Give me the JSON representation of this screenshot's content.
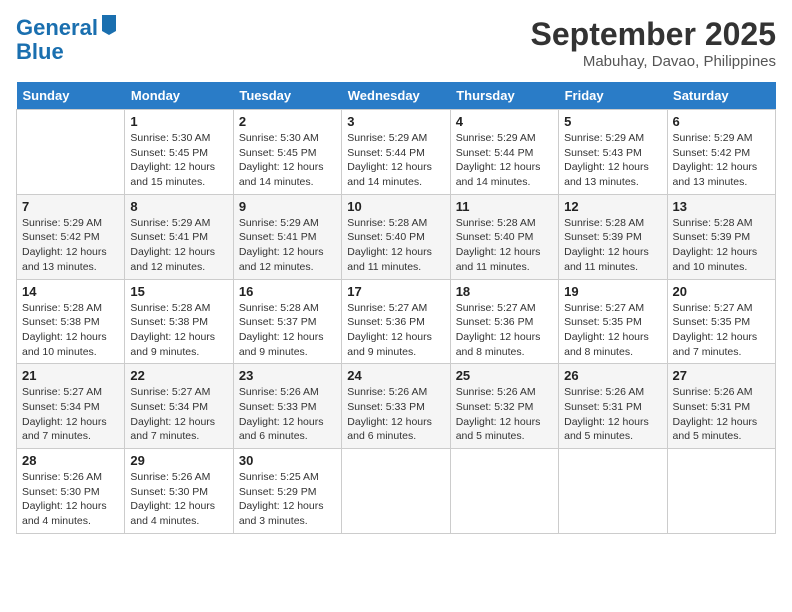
{
  "logo": {
    "line1": "General",
    "line2": "Blue"
  },
  "title": "September 2025",
  "location": "Mabuhay, Davao, Philippines",
  "days_of_week": [
    "Sunday",
    "Monday",
    "Tuesday",
    "Wednesday",
    "Thursday",
    "Friday",
    "Saturday"
  ],
  "weeks": [
    [
      {
        "day": "",
        "sunrise": "",
        "sunset": "",
        "daylight": ""
      },
      {
        "day": "1",
        "sunrise": "Sunrise: 5:30 AM",
        "sunset": "Sunset: 5:45 PM",
        "daylight": "Daylight: 12 hours and 15 minutes."
      },
      {
        "day": "2",
        "sunrise": "Sunrise: 5:30 AM",
        "sunset": "Sunset: 5:45 PM",
        "daylight": "Daylight: 12 hours and 14 minutes."
      },
      {
        "day": "3",
        "sunrise": "Sunrise: 5:29 AM",
        "sunset": "Sunset: 5:44 PM",
        "daylight": "Daylight: 12 hours and 14 minutes."
      },
      {
        "day": "4",
        "sunrise": "Sunrise: 5:29 AM",
        "sunset": "Sunset: 5:44 PM",
        "daylight": "Daylight: 12 hours and 14 minutes."
      },
      {
        "day": "5",
        "sunrise": "Sunrise: 5:29 AM",
        "sunset": "Sunset: 5:43 PM",
        "daylight": "Daylight: 12 hours and 13 minutes."
      },
      {
        "day": "6",
        "sunrise": "Sunrise: 5:29 AM",
        "sunset": "Sunset: 5:42 PM",
        "daylight": "Daylight: 12 hours and 13 minutes."
      }
    ],
    [
      {
        "day": "7",
        "sunrise": "Sunrise: 5:29 AM",
        "sunset": "Sunset: 5:42 PM",
        "daylight": "Daylight: 12 hours and 13 minutes."
      },
      {
        "day": "8",
        "sunrise": "Sunrise: 5:29 AM",
        "sunset": "Sunset: 5:41 PM",
        "daylight": "Daylight: 12 hours and 12 minutes."
      },
      {
        "day": "9",
        "sunrise": "Sunrise: 5:29 AM",
        "sunset": "Sunset: 5:41 PM",
        "daylight": "Daylight: 12 hours and 12 minutes."
      },
      {
        "day": "10",
        "sunrise": "Sunrise: 5:28 AM",
        "sunset": "Sunset: 5:40 PM",
        "daylight": "Daylight: 12 hours and 11 minutes."
      },
      {
        "day": "11",
        "sunrise": "Sunrise: 5:28 AM",
        "sunset": "Sunset: 5:40 PM",
        "daylight": "Daylight: 12 hours and 11 minutes."
      },
      {
        "day": "12",
        "sunrise": "Sunrise: 5:28 AM",
        "sunset": "Sunset: 5:39 PM",
        "daylight": "Daylight: 12 hours and 11 minutes."
      },
      {
        "day": "13",
        "sunrise": "Sunrise: 5:28 AM",
        "sunset": "Sunset: 5:39 PM",
        "daylight": "Daylight: 12 hours and 10 minutes."
      }
    ],
    [
      {
        "day": "14",
        "sunrise": "Sunrise: 5:28 AM",
        "sunset": "Sunset: 5:38 PM",
        "daylight": "Daylight: 12 hours and 10 minutes."
      },
      {
        "day": "15",
        "sunrise": "Sunrise: 5:28 AM",
        "sunset": "Sunset: 5:38 PM",
        "daylight": "Daylight: 12 hours and 9 minutes."
      },
      {
        "day": "16",
        "sunrise": "Sunrise: 5:28 AM",
        "sunset": "Sunset: 5:37 PM",
        "daylight": "Daylight: 12 hours and 9 minutes."
      },
      {
        "day": "17",
        "sunrise": "Sunrise: 5:27 AM",
        "sunset": "Sunset: 5:36 PM",
        "daylight": "Daylight: 12 hours and 9 minutes."
      },
      {
        "day": "18",
        "sunrise": "Sunrise: 5:27 AM",
        "sunset": "Sunset: 5:36 PM",
        "daylight": "Daylight: 12 hours and 8 minutes."
      },
      {
        "day": "19",
        "sunrise": "Sunrise: 5:27 AM",
        "sunset": "Sunset: 5:35 PM",
        "daylight": "Daylight: 12 hours and 8 minutes."
      },
      {
        "day": "20",
        "sunrise": "Sunrise: 5:27 AM",
        "sunset": "Sunset: 5:35 PM",
        "daylight": "Daylight: 12 hours and 7 minutes."
      }
    ],
    [
      {
        "day": "21",
        "sunrise": "Sunrise: 5:27 AM",
        "sunset": "Sunset: 5:34 PM",
        "daylight": "Daylight: 12 hours and 7 minutes."
      },
      {
        "day": "22",
        "sunrise": "Sunrise: 5:27 AM",
        "sunset": "Sunset: 5:34 PM",
        "daylight": "Daylight: 12 hours and 7 minutes."
      },
      {
        "day": "23",
        "sunrise": "Sunrise: 5:26 AM",
        "sunset": "Sunset: 5:33 PM",
        "daylight": "Daylight: 12 hours and 6 minutes."
      },
      {
        "day": "24",
        "sunrise": "Sunrise: 5:26 AM",
        "sunset": "Sunset: 5:33 PM",
        "daylight": "Daylight: 12 hours and 6 minutes."
      },
      {
        "day": "25",
        "sunrise": "Sunrise: 5:26 AM",
        "sunset": "Sunset: 5:32 PM",
        "daylight": "Daylight: 12 hours and 5 minutes."
      },
      {
        "day": "26",
        "sunrise": "Sunrise: 5:26 AM",
        "sunset": "Sunset: 5:31 PM",
        "daylight": "Daylight: 12 hours and 5 minutes."
      },
      {
        "day": "27",
        "sunrise": "Sunrise: 5:26 AM",
        "sunset": "Sunset: 5:31 PM",
        "daylight": "Daylight: 12 hours and 5 minutes."
      }
    ],
    [
      {
        "day": "28",
        "sunrise": "Sunrise: 5:26 AM",
        "sunset": "Sunset: 5:30 PM",
        "daylight": "Daylight: 12 hours and 4 minutes."
      },
      {
        "day": "29",
        "sunrise": "Sunrise: 5:26 AM",
        "sunset": "Sunset: 5:30 PM",
        "daylight": "Daylight: 12 hours and 4 minutes."
      },
      {
        "day": "30",
        "sunrise": "Sunrise: 5:25 AM",
        "sunset": "Sunset: 5:29 PM",
        "daylight": "Daylight: 12 hours and 3 minutes."
      },
      {
        "day": "",
        "sunrise": "",
        "sunset": "",
        "daylight": ""
      },
      {
        "day": "",
        "sunrise": "",
        "sunset": "",
        "daylight": ""
      },
      {
        "day": "",
        "sunrise": "",
        "sunset": "",
        "daylight": ""
      },
      {
        "day": "",
        "sunrise": "",
        "sunset": "",
        "daylight": ""
      }
    ]
  ]
}
